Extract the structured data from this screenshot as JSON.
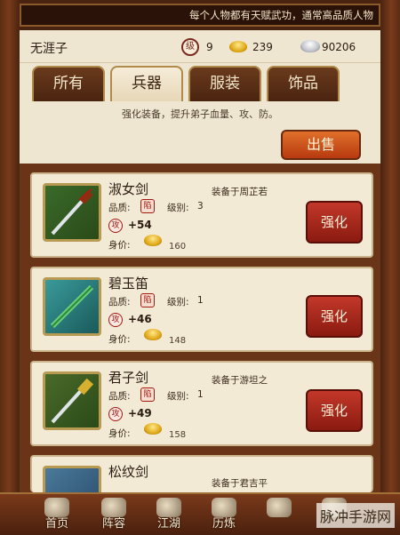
{
  "marquee": "每个人物都有天赋武功，通常高品质人物",
  "player": {
    "name": "无涯子",
    "level_icon": "级",
    "level": "9",
    "gold": "239",
    "silver": "90206"
  },
  "tabs": [
    {
      "label": "所有"
    },
    {
      "label": "兵器"
    },
    {
      "label": "服装"
    },
    {
      "label": "饰品"
    }
  ],
  "hint": "强化装备，提升弟子血量、攻、防。",
  "sell_label": "出售",
  "labels": {
    "quality": "品质:",
    "quality_icon": "陷",
    "level": "级别:",
    "atk_icon": "攻",
    "price": "身价:",
    "enhance": "强化"
  },
  "weapons": [
    {
      "name": "淑女剑",
      "level": "3",
      "equipped": "装备于周芷若",
      "atk": "+54",
      "price": "160"
    },
    {
      "name": "碧玉笛",
      "level": "1",
      "equipped": "",
      "atk": "+46",
      "price": "148"
    },
    {
      "name": "君子剑",
      "level": "1",
      "equipped": "装备于游坦之",
      "atk": "+49",
      "price": "158"
    },
    {
      "name": "松纹剑",
      "level": "",
      "equipped": "装备于君吉平",
      "atk": "",
      "price": ""
    }
  ],
  "nav": [
    {
      "label": "首页"
    },
    {
      "label": "阵容"
    },
    {
      "label": "江湖"
    },
    {
      "label": "历炼"
    },
    {
      "label": ""
    },
    {
      "label": ""
    }
  ],
  "watermark": "脉冲手游网"
}
